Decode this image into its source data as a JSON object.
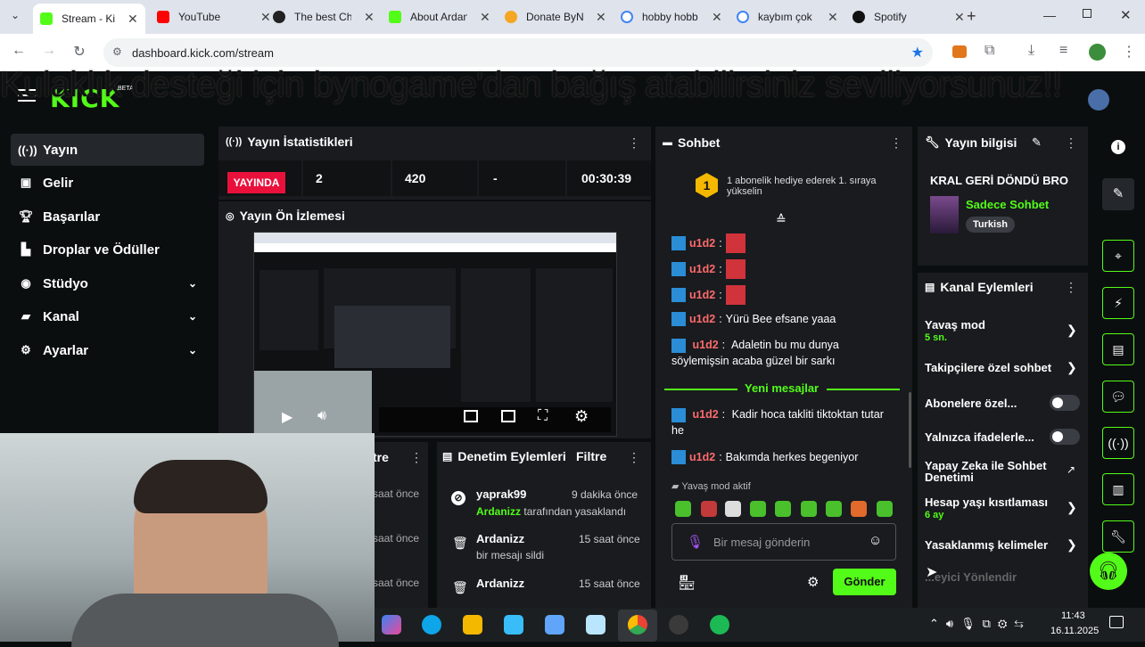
{
  "browser": {
    "tabs": [
      {
        "title": "Stream - Kick",
        "color": "#53fc18",
        "active": true
      },
      {
        "title": "YouTube",
        "color": "#ff0000"
      },
      {
        "title": "The best Cha",
        "color": "#ffffff"
      },
      {
        "title": "About Ardan",
        "color": "#53fc18"
      },
      {
        "title": "Donate ByN",
        "color": "#f5a623"
      },
      {
        "title": "hobby hobb",
        "color": "#4285f4"
      },
      {
        "title": "kaybım çok",
        "color": "#4285f4"
      },
      {
        "title": "Spotify",
        "color": "#1db954"
      }
    ],
    "url": "dashboard.kick.com/stream",
    "new_tab_glyph": "+"
  },
  "overlay_banner": "Kulaklık desteği için bynogame'dan bağış atabilirsiniz seviliyorsunuz!!",
  "header": {
    "logo": "KICK",
    "beta": "BETA"
  },
  "sidebar": {
    "items": [
      {
        "label": "Yayın",
        "icon": "broadcast-icon",
        "active": true
      },
      {
        "label": "Gelir",
        "icon": "dollar-icon"
      },
      {
        "label": "Başarılar",
        "icon": "trophy-icon"
      },
      {
        "label": "Droplar ve Ödüller",
        "icon": "gift-icon"
      },
      {
        "label": "Stüdyo",
        "icon": "studio-icon",
        "expandable": true
      },
      {
        "label": "Kanal",
        "icon": "channel-icon",
        "expandable": true
      },
      {
        "label": "Ayarlar",
        "icon": "gear-icon",
        "expandable": true
      }
    ]
  },
  "stats": {
    "title": "Yayın İstatistikleri",
    "live": "YAYINDA",
    "viewers": "2",
    "followers": "420",
    "dash": "-",
    "time": "00:30:39"
  },
  "preview": {
    "title": "Yayın Ön İzlemesi"
  },
  "moderation": {
    "title": "Denetim Eylemleri",
    "filter": "Filtre",
    "left_title": "tre",
    "left_times": [
      "saat önce",
      "saat önce",
      "saat önce"
    ],
    "items": [
      {
        "user": "yaprak99",
        "time": "9 dakika önce",
        "desc_user": "Ardanizz",
        "desc": "tarafından yasaklandı",
        "icon": "ban-icon"
      },
      {
        "user": "Ardanizz",
        "time": "15 saat önce",
        "desc": "bir mesajı sildi",
        "icon": "trash-icon"
      },
      {
        "user": "Ardanizz",
        "time": "15 saat önce",
        "desc": "",
        "icon": "trash-icon"
      }
    ]
  },
  "chat": {
    "title": "Sohbet",
    "gift_text": "1 abonelik hediye ederek 1. sıraya yükselin",
    "gift_num": "1",
    "messages": [
      {
        "user": "u1d2",
        "text": "",
        "emote": true
      },
      {
        "user": "u1d2",
        "text": "",
        "emote": true
      },
      {
        "user": "u1d2",
        "text": "",
        "emote": true
      },
      {
        "user": "u1d2",
        "text": "Yürü Bee efsane yaaa"
      },
      {
        "user": "u1d2",
        "text": "Adaletin bu mu dunya söylemişsin acaba güzel bir sarkı"
      }
    ],
    "new_messages": "Yeni mesajlar",
    "new": [
      {
        "user": "u1d2",
        "text": "Kadir hoca takliti tiktoktan tutar he"
      },
      {
        "user": "u1d2",
        "text": "Bakımda herkes begeniyor"
      }
    ],
    "slow_mode": "Yavaş mod aktif",
    "placeholder": "Bir mesaj gönderin",
    "send": "Gönder"
  },
  "stream_info": {
    "title": "Yayın bilgisi",
    "stream_title": "KRAL GERİ DÖNDÜ BRO",
    "category": "Sadece Sohbet",
    "tag": "Turkish"
  },
  "channel_actions": {
    "title": "Kanal Eylemleri",
    "slow_mode": "Yavaş mod",
    "slow_value": "5 sn.",
    "followers_only": "Takipçilere özel sohbet",
    "subs_only": "Abonelere özel...",
    "emotes_only": "Yalnızca ifadelerle...",
    "ai_mod": "Yapay Zeka ile Sohbet Denetimi",
    "account_age": "Hesap yaşı kısıtlaması",
    "account_age_value": "6 ay",
    "banned_words": "Yasaklanmış kelimeler",
    "faded": "...eyici Yönlendir"
  },
  "taskbar": {
    "time": "11:43",
    "date": "16.11.2025"
  }
}
